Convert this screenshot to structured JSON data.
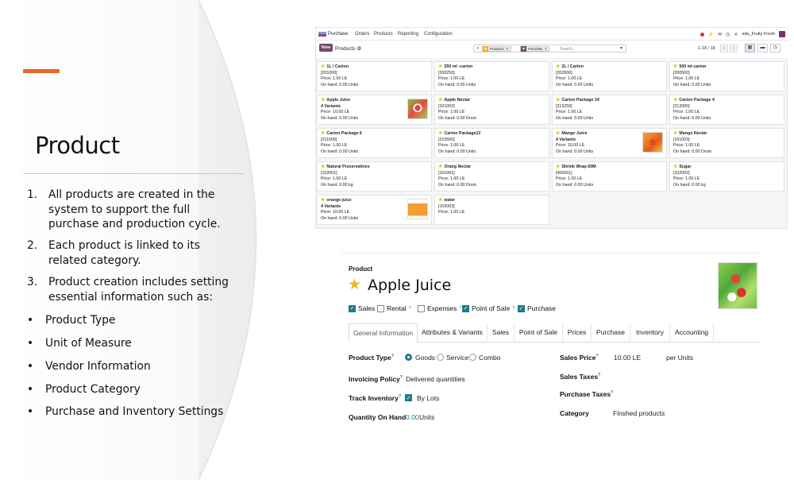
{
  "slide": {
    "title": "Product",
    "numbered": [
      {
        "n": "1.",
        "text": "All products are created in the system to support the full purchase and production cycle."
      },
      {
        "n": "2.",
        "text": "Each product is linked to its related category."
      },
      {
        "n": "3.",
        "text": "Product creation includes setting essential information such as:"
      }
    ],
    "bullets": [
      "Product Type",
      "Unit of Measure",
      "Vendor Information",
      "Product Category",
      "Purchase and Inventory Settings"
    ],
    "bullet_glyph": "•",
    "accent_color": "#e8692c"
  },
  "kanban": {
    "navbar": {
      "app": "Purchase",
      "menus": [
        "Orders",
        "Products",
        "Reporting",
        "Configuration"
      ],
      "user": "edu_Fruity Fresh"
    },
    "control": {
      "new_label": "New",
      "breadcrumb": "Products ⚙",
      "facets": [
        "Products",
        "Favorites"
      ],
      "search_placeholder": "Search...",
      "pager": "1-18 / 18"
    },
    "cards": [
      {
        "name": "1L / Carton",
        "code": "[201000]",
        "lines": [
          "Price: 1.00 LE",
          "On hand: 0.00 Units"
        ]
      },
      {
        "name": "250 ml -carton",
        "code": "[200250]",
        "lines": [
          "Price: 1.00 LE",
          "On hand: 0.00 Units"
        ]
      },
      {
        "name": "2L / Carton",
        "code": "[202000]",
        "lines": [
          "Price: 1.00 LE",
          "On hand: 0.00 Units"
        ]
      },
      {
        "name": "500 ml carton",
        "code": "[200500]",
        "lines": [
          "Price: 1.00 LE",
          "On hand: 0.00 Units"
        ]
      },
      {
        "name": "Apple Juice",
        "code": "4 Variants",
        "lines": [
          "Price: 10.00 LE",
          "On hand: 0.00 Units"
        ],
        "thumb": "apple"
      },
      {
        "name": "Apple Nectar",
        "code": "[101002]",
        "lines": [
          "Price: 1.00 LE",
          "On hand: 0.00 Drum"
        ]
      },
      {
        "name": "Carton Package 24",
        "code": "[213250]",
        "lines": [
          "Price: 1.00 LE",
          "On hand: 0.00 Units"
        ]
      },
      {
        "name": "Carton Package 4",
        "code": "[212000]",
        "lines": [
          "Price: 1.00 LE",
          "On hand: 0.00 Units"
        ]
      },
      {
        "name": "Carton Package 6",
        "code": "[211000]",
        "lines": [
          "Price: 1.00 LE",
          "On hand: 0.00 Units"
        ]
      },
      {
        "name": "Carton Package12",
        "code": "[210500]",
        "lines": [
          "Price: 1.00 LE",
          "On hand: 0.00 Units"
        ]
      },
      {
        "name": "Mango Juice",
        "code": "4 Variants",
        "lines": [
          "Price: 10.00 LE",
          "On hand: 0.00 Units"
        ],
        "thumb": "mango"
      },
      {
        "name": "Mango Nectar",
        "code": "[101003]",
        "lines": [
          "Price: 1.00 LE",
          "On hand: 0.00 Drum"
        ]
      },
      {
        "name": "Natural Preservatives",
        "code": "[102001]",
        "lines": [
          "Price: 1.00 LE",
          "On hand: 0.00 kg"
        ]
      },
      {
        "name": "Orang Nectar",
        "code": "[101001]",
        "lines": [
          "Price: 1.00 LE",
          "On hand: 0.00 Drum"
        ]
      },
      {
        "name": "Shrink Wrap-50M",
        "code": "[400001]",
        "lines": [
          "Price: 1.00 LE",
          "On hand: 0.00 Units"
        ]
      },
      {
        "name": "Sugar",
        "code": "[102002]",
        "lines": [
          "Price: 1.00 LE",
          "On hand: 0.00 kg"
        ]
      },
      {
        "name": "orange juice",
        "code": "4 Variants",
        "lines": [
          "Price: 10.00 LE",
          "On hand: 0.00 Units"
        ],
        "thumb": "orange"
      },
      {
        "name": "water",
        "code": "[102003]",
        "lines": [
          "Price: 1.00 LE"
        ]
      }
    ]
  },
  "form": {
    "label": "Product",
    "name": "Apple Juice",
    "checkboxes": [
      {
        "label": "Sales",
        "checked": true,
        "help": false
      },
      {
        "label": "Rental",
        "checked": false,
        "help": true
      },
      {
        "label": "Expenses",
        "checked": false,
        "help": true
      },
      {
        "label": "Point of Sale",
        "checked": true,
        "help": true
      },
      {
        "label": "Purchase",
        "checked": true,
        "help": false
      }
    ],
    "help_mark": "?",
    "tabs": [
      "General Information",
      "Attributes & Variants",
      "Sales",
      "Point of Sale",
      "Prices",
      "Purchase",
      "Inventory",
      "Accounting"
    ],
    "active_tab": "General Information",
    "fields": {
      "product_type_label": "Product Type",
      "product_type_options": [
        "Goods",
        "Service",
        "Combo"
      ],
      "product_type_selected": "Goods",
      "invoicing_policy_label": "Invoicing Policy",
      "invoicing_policy_value": "Delivered quantities",
      "track_inventory_label": "Track Inventory",
      "track_inventory_value": "By Lots",
      "qty_on_hand_label": "Quantity On Hand",
      "qty_on_hand_value": "0.00",
      "qty_on_hand_unit": "Units",
      "sales_price_label": "Sales Price",
      "sales_price_value": "10.00 LE",
      "sales_price_unit": "per Units",
      "sales_taxes_label": "Sales Taxes",
      "purchase_taxes_label": "Purchase Taxes",
      "category_label": "Category",
      "category_value": "Finshed products"
    },
    "accent_color": "#1f7a8c",
    "star_color": "#f3b520"
  },
  "brand_color": "#714b67"
}
